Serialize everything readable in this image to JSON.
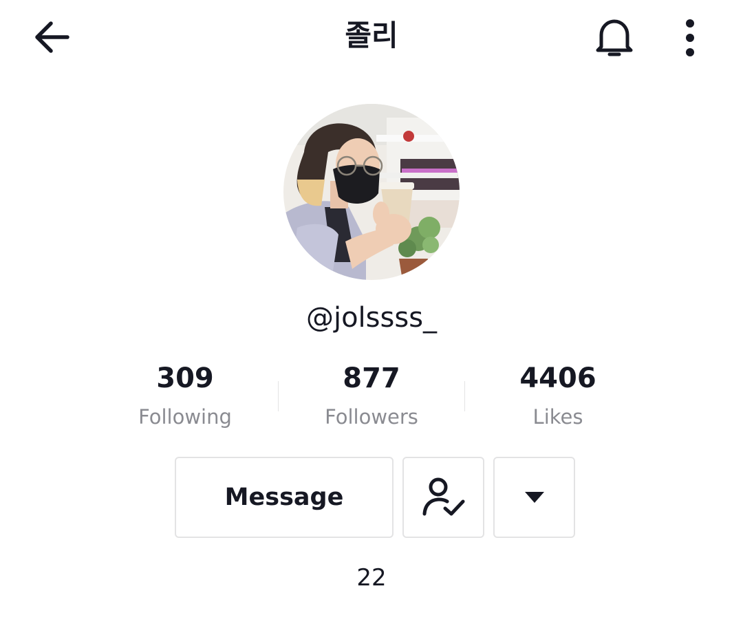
{
  "header": {
    "title": "졸리",
    "back_icon": "arrow-left-icon",
    "notification_icon": "bell-icon",
    "more_icon": "more-vertical-icon"
  },
  "profile": {
    "avatar": "profile-photo",
    "username": "@jolssss_",
    "bio": "22"
  },
  "stats": [
    {
      "value": "309",
      "label": "Following"
    },
    {
      "value": "877",
      "label": "Followers"
    },
    {
      "value": "4406",
      "label": "Likes"
    }
  ],
  "actions": {
    "message_label": "Message",
    "friend_icon": "user-check-icon",
    "dropdown_icon": "caret-down-icon"
  },
  "colors": {
    "text_primary": "#161823",
    "text_secondary": "#8a8b91",
    "border": "#e3e3e4"
  }
}
